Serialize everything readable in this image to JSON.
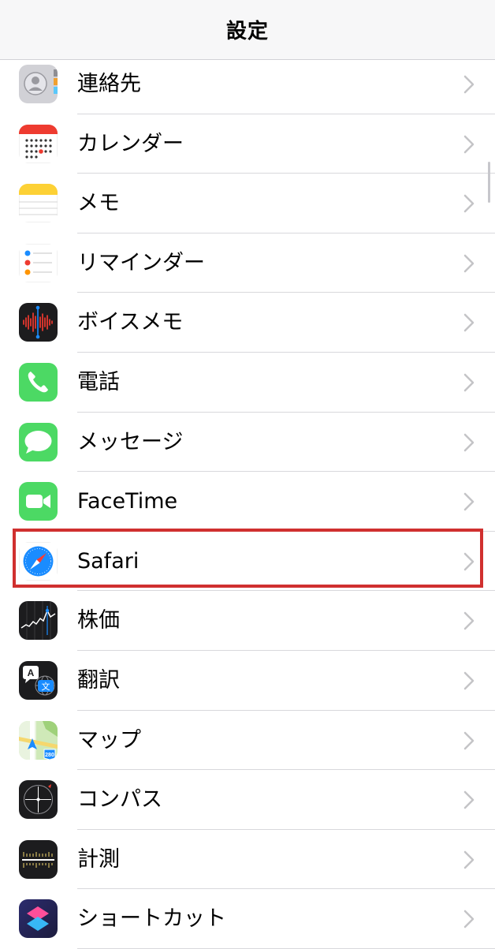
{
  "navbar": {
    "title": "設定"
  },
  "rows": [
    {
      "label": "連絡先",
      "icon": "contacts-icon"
    },
    {
      "label": "カレンダー",
      "icon": "calendar-icon"
    },
    {
      "label": "メモ",
      "icon": "notes-icon"
    },
    {
      "label": "リマインダー",
      "icon": "reminders-icon"
    },
    {
      "label": "ボイスメモ",
      "icon": "voice-memos-icon"
    },
    {
      "label": "電話",
      "icon": "phone-icon"
    },
    {
      "label": "メッセージ",
      "icon": "messages-icon"
    },
    {
      "label": "FaceTime",
      "icon": "facetime-icon"
    },
    {
      "label": "Safari",
      "icon": "safari-icon"
    },
    {
      "label": "株価",
      "icon": "stocks-icon"
    },
    {
      "label": "翻訳",
      "icon": "translate-icon"
    },
    {
      "label": "マップ",
      "icon": "maps-icon"
    },
    {
      "label": "コンパス",
      "icon": "compass-icon"
    },
    {
      "label": "計測",
      "icon": "measure-icon"
    },
    {
      "label": "ショートカット",
      "icon": "shortcuts-icon"
    }
  ],
  "highlight": {
    "row": "Safari",
    "color": "#d0302f"
  },
  "colors": {
    "phone": "#4cd964",
    "messages": "#4cd964",
    "facetime": "#4cd964",
    "safari": "#1a8cff"
  },
  "translate_icon": {
    "glyph_a": "A",
    "glyph_b": "文"
  },
  "maps_icon": {
    "badge": "280"
  }
}
